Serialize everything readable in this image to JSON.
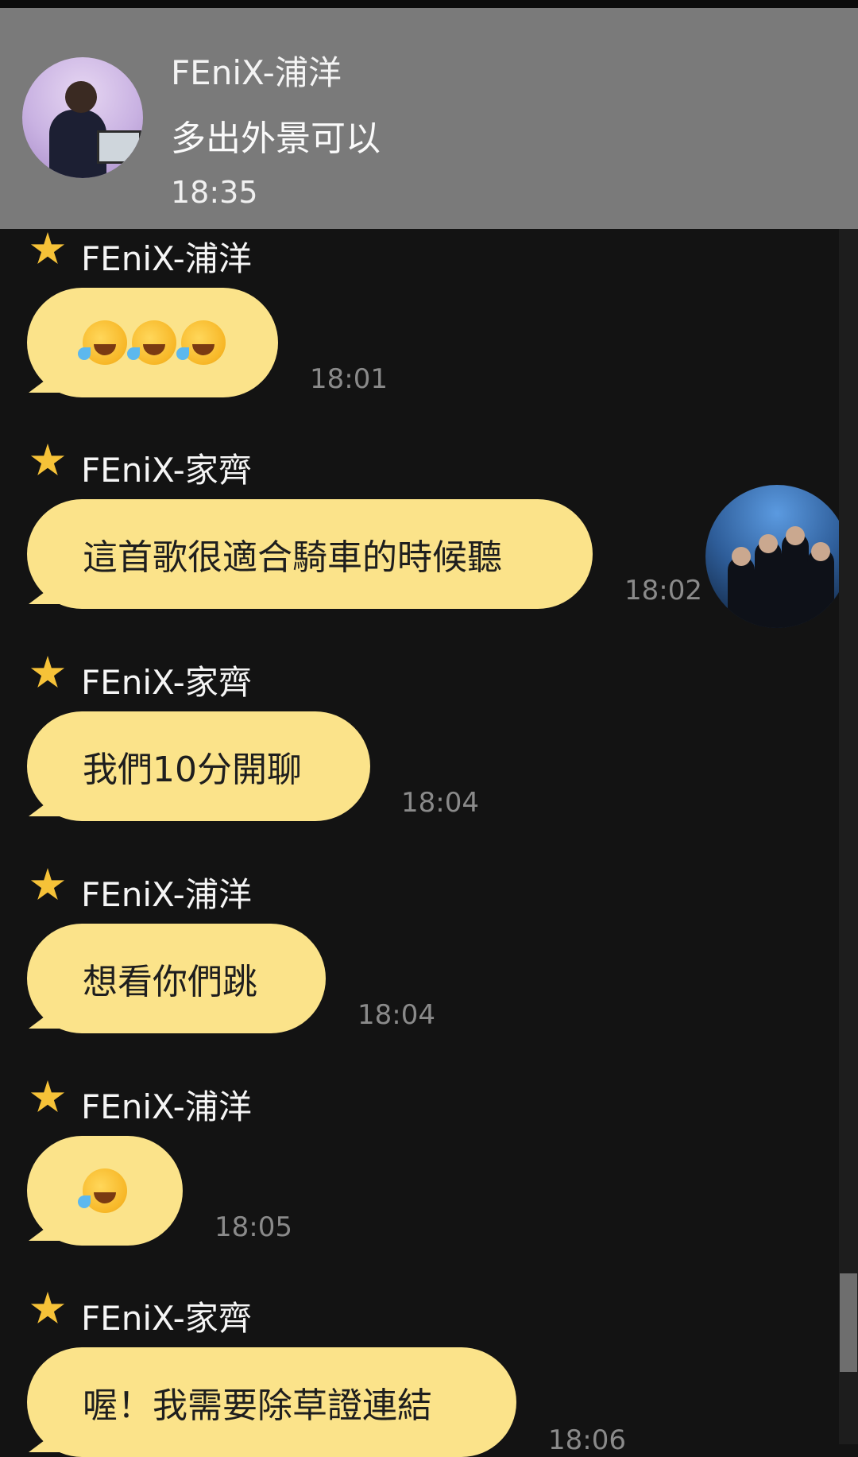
{
  "notification": {
    "sender": "FEniX-浦洋",
    "message": "多出外景可以",
    "time": "18:35"
  },
  "messages": [
    {
      "sender": "FEniX-浦洋",
      "text": "🤣🤣🤣",
      "time": "18:01",
      "emoji_count": 3
    },
    {
      "sender": "FEniX-家齊",
      "text": "這首歌很適合騎車的時候聽",
      "time": "18:02"
    },
    {
      "sender": "FEniX-家齊",
      "text": "我們10分開聊",
      "time": "18:04"
    },
    {
      "sender": "FEniX-浦洋",
      "text": "想看你們跳",
      "time": "18:04"
    },
    {
      "sender": "FEniX-浦洋",
      "text": "🤣",
      "time": "18:05",
      "emoji_count": 1
    },
    {
      "sender": "FEniX-家齊",
      "text": "喔！我需要除草證連結",
      "time": "18:06"
    }
  ],
  "colors": {
    "background": "#131313",
    "bubble": "#fbe38a",
    "star": "#f6c238",
    "notification_bg": "#7a7a7a",
    "timestamp": "#8a8a8a"
  },
  "icons": {
    "sender_badge": "star-icon",
    "emoji": "rolling-on-floor-laughing-emoji"
  }
}
